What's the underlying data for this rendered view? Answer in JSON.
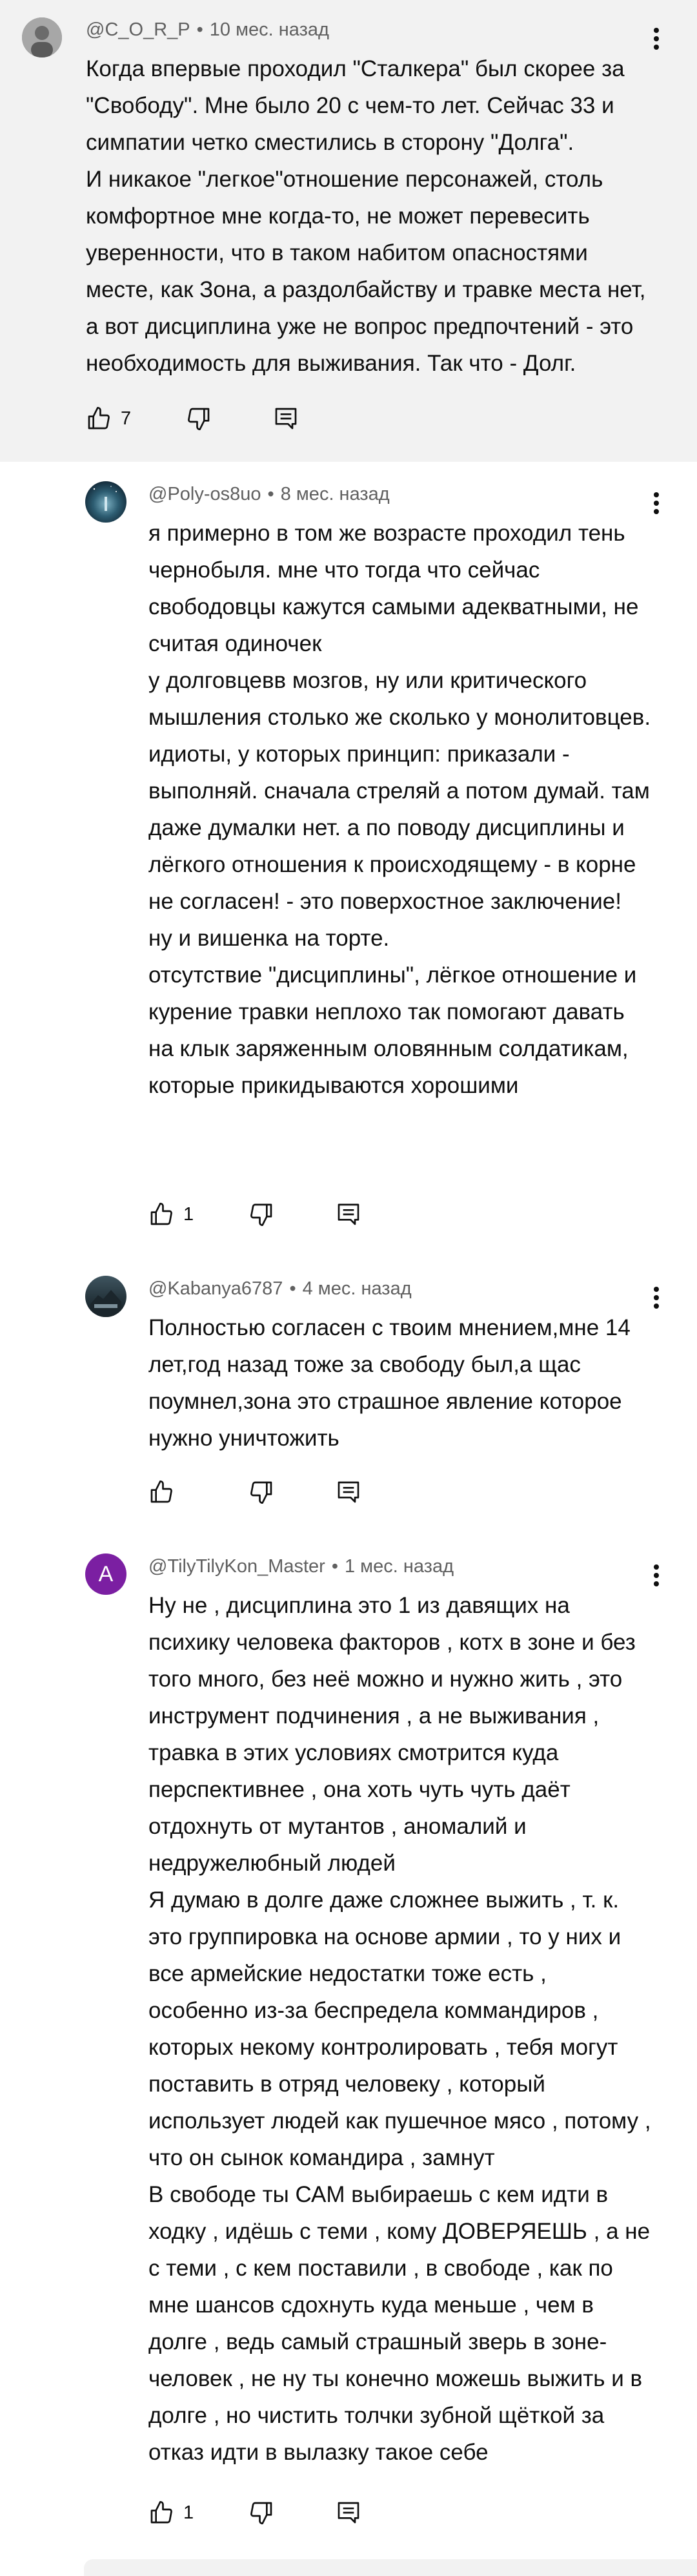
{
  "comments": [
    {
      "author": "@C_O_R_P",
      "time": "10 мес. назад",
      "text": "Когда впервые проходил \"Сталкера\" был скорее за \"Свободу\". Мне было 20 с чем-то лет. Сейчас 33 и симпатии четко сместились в сторону \"Долга\".\nИ никакое \"легкое\"отношение персонажей, столь комфортное мне когда-то, не может перевесить уверенности, что в таком набитом опасностями месте, как Зона, а раздолбайству и травке места нет, а вот дисциплина уже не вопрос предпочтений - это необходимость для выживания. Так что - Долг.",
      "likes": "7",
      "avatar_icon": "profile-photo-icon",
      "avatar_color": "#8a8a8a"
    },
    {
      "author": "@Poly-os8uo",
      "time": "8 мес. назад",
      "text": "я примерно в том же возрасте проходил тень чернобыля. мне что тогда что сейчас свободовцы кажутся самыми адекватными, не считая одиночек\nу долговцевв мозгов, ну или критического мышления столько же сколько у монолитовцев. идиоты, у которых принцип: приказали - выполняй. сначала стреляй а потом думай. там даже думалки нет. а по поводу дисциплины и лёгкого отношения к происходящему - в корне не согласен! - это поверхостное заключение!\nну и вишенка на торте.\nотсутствие \"дисциплины\", лёгкое отношение и курение травки неплохо так помогают давать на клык заряженным оловянным солдатикам, которые прикидываются хорошими",
      "likes": "1",
      "avatar_icon": "night-sky-photo-icon",
      "avatar_color": "#1f4a5e"
    },
    {
      "author": "@Kabanya6787",
      "time": "4 мес. назад",
      "text": "Полностью согласен с твоим мнением,мне 14 лет,год назад тоже за свободу был,а щас поумнел,зона это страшное явление которое нужно уничтожить",
      "likes": "",
      "avatar_icon": "game-art-photo-icon",
      "avatar_color": "#2b3a44"
    },
    {
      "author": "@TilyTilyKon_Master",
      "time": "1 мес. назад",
      "text": "Ну не , дисциплина это 1 из давящих на психику человека факторов , котх в зоне и без того много, без неё можно и нужно жить , это инструмент подчинения , а не выживания , травка в этих условиях смотрится куда перспективнее , она хоть чуть чуть даёт отдохнуть от мутантов , аномалий и недружелюбный людей\nЯ думаю в долге даже сложнее выжить , т. к. это группировка на основе армии , то у них и все армейские недостатки тоже есть , особенно из-за беспредела коммандиров , которых некому контролировать , тебя могут поставить в отряд человеку , который использует людей как пушечное мясо , потому , что он сынок командира , замнут\nВ свободе ты САМ выбираешь с кем идти в ходку , идёшь с теми , кому ДОВЕРЯЕШЬ , а не с теми , с кем поставили , в свободе , как по мне шансов сдохнуть куда меньше , чем в долге , ведь самый страшный зверь в зоне-человек , не ну ты конечно можешь выжить и в долге , но чистить толчки зубной щёткой за отказ идти в вылазку такое себе",
      "likes": "1",
      "avatar_letter": "A",
      "avatar_color": "#7b1fa2"
    }
  ],
  "icons": {
    "like": "thumb-up-icon",
    "dislike": "thumb-down-icon",
    "reply": "reply-icon",
    "more": "more-vertical-icon"
  },
  "colors": {
    "highlight_bg": "#f2f2f2",
    "meta_text": "#606060",
    "text": "#0f0f0f"
  }
}
